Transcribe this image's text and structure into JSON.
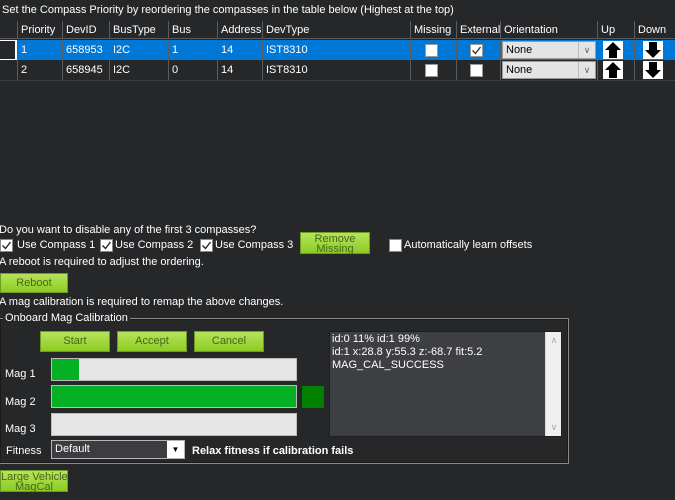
{
  "instructions": "Set the Compass Priority by reordering the compasses in the table below (Highest at the top)",
  "table": {
    "columns": [
      "Priority",
      "DevID",
      "BusType",
      "Bus",
      "Address",
      "DevType",
      "Missing",
      "External",
      "Orientation",
      "Up",
      "Down"
    ],
    "rows": [
      {
        "priority": "1",
        "devid": "658953",
        "bustype": "I2C",
        "bus": "1",
        "address": "14",
        "devtype": "IST8310",
        "missing": false,
        "external": true,
        "orientation": "None",
        "selected": true
      },
      {
        "priority": "2",
        "devid": "658945",
        "bustype": "I2C",
        "bus": "0",
        "address": "14",
        "devtype": "IST8310",
        "missing": false,
        "external": false,
        "orientation": "None",
        "selected": false
      }
    ],
    "up_icon": "arrow-up-icon",
    "down_icon": "arrow-down-icon"
  },
  "disable_prompt": "Do you want to disable any of the first 3 compasses?",
  "use_compass": [
    {
      "label": "Use Compass 1",
      "checked": true
    },
    {
      "label": "Use Compass 2",
      "checked": true
    },
    {
      "label": "Use Compass 3",
      "checked": true
    }
  ],
  "remove_missing_label": [
    "Remove",
    "Missing"
  ],
  "auto_learn": {
    "label": "Automatically learn offsets",
    "checked": false
  },
  "reboot_note": "A reboot is required to adjust the ordering.",
  "reboot_label": "Reboot",
  "mag_cal_note": "A mag calibration is required to remap the above changes.",
  "onboard": {
    "title": "Onboard Mag Calibration",
    "start_label": "Start",
    "accept_label": "Accept",
    "cancel_label": "Cancel",
    "mags": [
      {
        "label": "Mag 1",
        "progress": 11
      },
      {
        "label": "Mag 2",
        "progress": 100
      },
      {
        "label": "Mag 3",
        "progress": 0
      }
    ],
    "status_color": "#008000",
    "log": [
      "id:0 11% id:1 99%",
      "id:1 x:28.8 y:55.3 z:-68.7 fit:5.2",
      "MAG_CAL_SUCCESS"
    ],
    "fitness_label": "Fitness",
    "fitness_value": "Default",
    "relax_label": "Relax fitness if calibration fails"
  },
  "large_vehicle_label": [
    "Large Vehicle",
    "MagCal"
  ],
  "colors": {
    "background": "#262729",
    "selection": "#0078d7",
    "button_green": "#9bd63a",
    "progress_green": "#06b025"
  }
}
